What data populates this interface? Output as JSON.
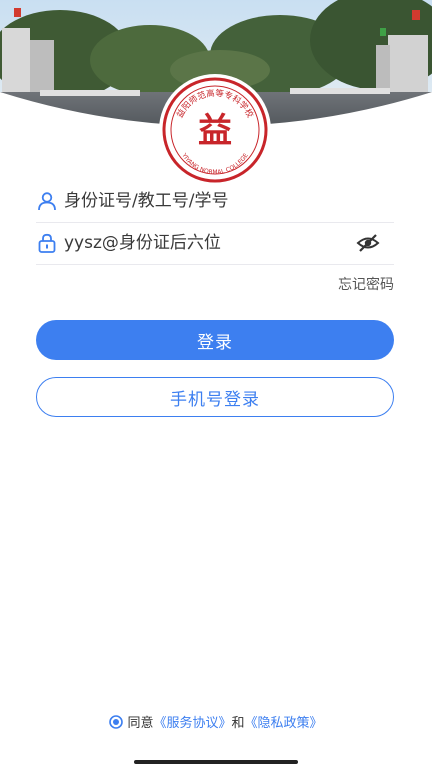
{
  "logo": {
    "top_text": "益阳师范高等专科学校",
    "bottom_text": "YIYANG NORMAL COLLEGE",
    "emblem": "益"
  },
  "login": {
    "username_placeholder": "身份证号/教工号/学号",
    "password_placeholder": "yysz@身份证后六位",
    "forgot_label": "忘记密码",
    "login_button": "登录",
    "phone_login_button": "手机号登录"
  },
  "agreement": {
    "prefix": "同意",
    "service_link": "《服务协议》",
    "conjunction": "和",
    "privacy_link": "《隐私政策》"
  },
  "icons": {
    "user": "user-icon",
    "lock": "lock-icon",
    "eye_off": "eye-off-icon",
    "radio": "radio-checked-icon"
  },
  "colors": {
    "primary": "#3d7ff0",
    "logo_red": "#c8252a"
  }
}
